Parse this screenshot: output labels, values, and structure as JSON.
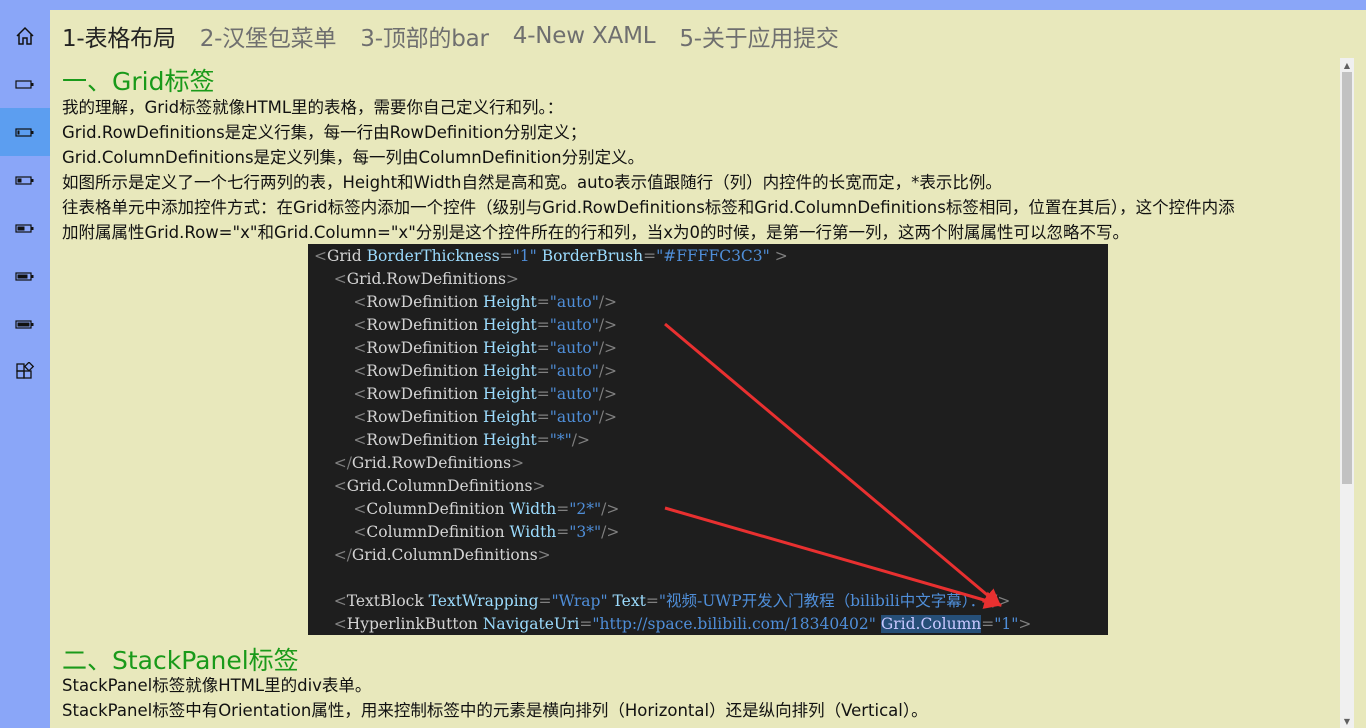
{
  "sidebar": {
    "items": [
      {
        "icon": "home-icon"
      },
      {
        "icon": "battery-empty-icon"
      },
      {
        "icon": "battery-low-icon",
        "active": true
      },
      {
        "icon": "battery-quarter-icon"
      },
      {
        "icon": "battery-half-icon"
      },
      {
        "icon": "battery-threequarter-icon"
      },
      {
        "icon": "battery-full-icon"
      },
      {
        "icon": "apps-add-icon"
      }
    ]
  },
  "tabs": [
    {
      "label": "1-表格布局",
      "active": true
    },
    {
      "label": "2-汉堡包菜单"
    },
    {
      "label": "3-顶部的bar"
    },
    {
      "label": "4-New XAML"
    },
    {
      "label": "5-关于应用提交"
    }
  ],
  "section1": {
    "heading": "一、Grid标签",
    "lines": [
      "我的理解，Grid标签就像HTML里的表格，需要你自己定义行和列。：",
      "Grid.RowDefinitions是定义行集，每一行由RowDefinition分别定义；",
      "Grid.ColumnDefinitions是定义列集，每一列由ColumnDefinition分别定义。",
      "如图所示是定义了一个七行两列的表，Height和Width自然是高和宽。auto表示值跟随行（列）内控件的长宽而定，*表示比例。",
      "往表格单元中添加控件方式：在Grid标签内添加一个控件（级别与Grid.RowDefinitions标签和Grid.ColumnDefinitions标签相同，位置在其后），这个控件内添",
      "加附属属性Grid.Row=\"x\"和Grid.Column=\"x\"分别是这个控件所在的行和列，当x为0的时候，是第一行第一列，这两个附属属性可以忽略不写。"
    ]
  },
  "code_image": {
    "lines": [
      [
        {
          "t": "<",
          "c": "p"
        },
        {
          "t": "Grid",
          "c": "el"
        },
        {
          "t": " BorderThickness",
          "c": "at"
        },
        {
          "t": "=",
          "c": "p"
        },
        {
          "t": "\"1\"",
          "c": "val"
        },
        {
          "t": " BorderBrush",
          "c": "at"
        },
        {
          "t": "=",
          "c": "p"
        },
        {
          "t": "\"#FFFFC3C3\"",
          "c": "val"
        },
        {
          "t": " >",
          "c": "p"
        }
      ],
      [
        {
          "t": "    <",
          "c": "p"
        },
        {
          "t": "Grid.RowDefinitions",
          "c": "el"
        },
        {
          "t": ">",
          "c": "p"
        }
      ],
      [
        {
          "t": "        <",
          "c": "p"
        },
        {
          "t": "RowDefinition",
          "c": "el"
        },
        {
          "t": " Height",
          "c": "at"
        },
        {
          "t": "=",
          "c": "p"
        },
        {
          "t": "\"auto\"",
          "c": "val"
        },
        {
          "t": "/>",
          "c": "p"
        }
      ],
      [
        {
          "t": "        <",
          "c": "p"
        },
        {
          "t": "RowDefinition",
          "c": "el"
        },
        {
          "t": " Height",
          "c": "at"
        },
        {
          "t": "=",
          "c": "p"
        },
        {
          "t": "\"auto\"",
          "c": "val"
        },
        {
          "t": "/>",
          "c": "p"
        }
      ],
      [
        {
          "t": "        <",
          "c": "p"
        },
        {
          "t": "RowDefinition",
          "c": "el"
        },
        {
          "t": " Height",
          "c": "at"
        },
        {
          "t": "=",
          "c": "p"
        },
        {
          "t": "\"auto\"",
          "c": "val"
        },
        {
          "t": "/>",
          "c": "p"
        }
      ],
      [
        {
          "t": "        <",
          "c": "p"
        },
        {
          "t": "RowDefinition",
          "c": "el"
        },
        {
          "t": " Height",
          "c": "at"
        },
        {
          "t": "=",
          "c": "p"
        },
        {
          "t": "\"auto\"",
          "c": "val"
        },
        {
          "t": "/>",
          "c": "p"
        }
      ],
      [
        {
          "t": "        <",
          "c": "p"
        },
        {
          "t": "RowDefinition",
          "c": "el"
        },
        {
          "t": " Height",
          "c": "at"
        },
        {
          "t": "=",
          "c": "p"
        },
        {
          "t": "\"auto\"",
          "c": "val"
        },
        {
          "t": "/>",
          "c": "p"
        }
      ],
      [
        {
          "t": "        <",
          "c": "p"
        },
        {
          "t": "RowDefinition",
          "c": "el"
        },
        {
          "t": " Height",
          "c": "at"
        },
        {
          "t": "=",
          "c": "p"
        },
        {
          "t": "\"auto\"",
          "c": "val"
        },
        {
          "t": "/>",
          "c": "p"
        }
      ],
      [
        {
          "t": "        <",
          "c": "p"
        },
        {
          "t": "RowDefinition",
          "c": "el"
        },
        {
          "t": " Height",
          "c": "at"
        },
        {
          "t": "=",
          "c": "p"
        },
        {
          "t": "\"*\"",
          "c": "val"
        },
        {
          "t": "/>",
          "c": "p"
        }
      ],
      [
        {
          "t": "    </",
          "c": "p"
        },
        {
          "t": "Grid.RowDefinitions",
          "c": "el"
        },
        {
          "t": ">",
          "c": "p"
        }
      ],
      [
        {
          "t": "    <",
          "c": "p"
        },
        {
          "t": "Grid.ColumnDefinitions",
          "c": "el"
        },
        {
          "t": ">",
          "c": "p"
        }
      ],
      [
        {
          "t": "        <",
          "c": "p"
        },
        {
          "t": "ColumnDefinition",
          "c": "el"
        },
        {
          "t": " Width",
          "c": "at"
        },
        {
          "t": "=",
          "c": "p"
        },
        {
          "t": "\"2*\"",
          "c": "val"
        },
        {
          "t": "/>",
          "c": "p"
        }
      ],
      [
        {
          "t": "        <",
          "c": "p"
        },
        {
          "t": "ColumnDefinition",
          "c": "el"
        },
        {
          "t": " Width",
          "c": "at"
        },
        {
          "t": "=",
          "c": "p"
        },
        {
          "t": "\"3*\"",
          "c": "val"
        },
        {
          "t": "/>",
          "c": "p"
        }
      ],
      [
        {
          "t": "    </",
          "c": "p"
        },
        {
          "t": "Grid.ColumnDefinitions",
          "c": "el"
        },
        {
          "t": ">",
          "c": "p"
        }
      ],
      [],
      [
        {
          "t": "    <",
          "c": "p"
        },
        {
          "t": "TextBlock",
          "c": "el"
        },
        {
          "t": " TextWrapping",
          "c": "at"
        },
        {
          "t": "=",
          "c": "p"
        },
        {
          "t": "\"Wrap\"",
          "c": "val"
        },
        {
          "t": " Text",
          "c": "at"
        },
        {
          "t": "=",
          "c": "p"
        },
        {
          "t": "\"视频-UWP开发入门教程（bilibili中文字幕）：\"",
          "c": "val"
        },
        {
          "t": "/>",
          "c": "p"
        }
      ],
      [
        {
          "t": "    <",
          "c": "p"
        },
        {
          "t": "HyperlinkButton",
          "c": "el"
        },
        {
          "t": " NavigateUri",
          "c": "at"
        },
        {
          "t": "=",
          "c": "p"
        },
        {
          "t": "\"http://space.bilibili.com/18340402\"",
          "c": "val"
        },
        {
          "t": " ",
          "c": "p"
        },
        {
          "t": "Grid.Column",
          "c": "sel"
        },
        {
          "t": "=",
          "c": "p"
        },
        {
          "t": "\"1\"",
          "c": "val"
        },
        {
          "t": ">",
          "c": "p"
        }
      ]
    ]
  },
  "section2": {
    "heading": "二、StackPanel标签",
    "lines": [
      "StackPanel标签就像HTML里的div表单。",
      "StackPanel标签中有Orientation属性，用来控制标签中的元素是横向排列（Horizontal）还是纵向排列（Vertical）。"
    ]
  },
  "colors": {
    "background": "#e8e8bc",
    "sidebar": "#8aa6f8",
    "sidebar_active": "#5c9ef0",
    "heading": "#1a9a1a",
    "arrow": "#e83030"
  }
}
